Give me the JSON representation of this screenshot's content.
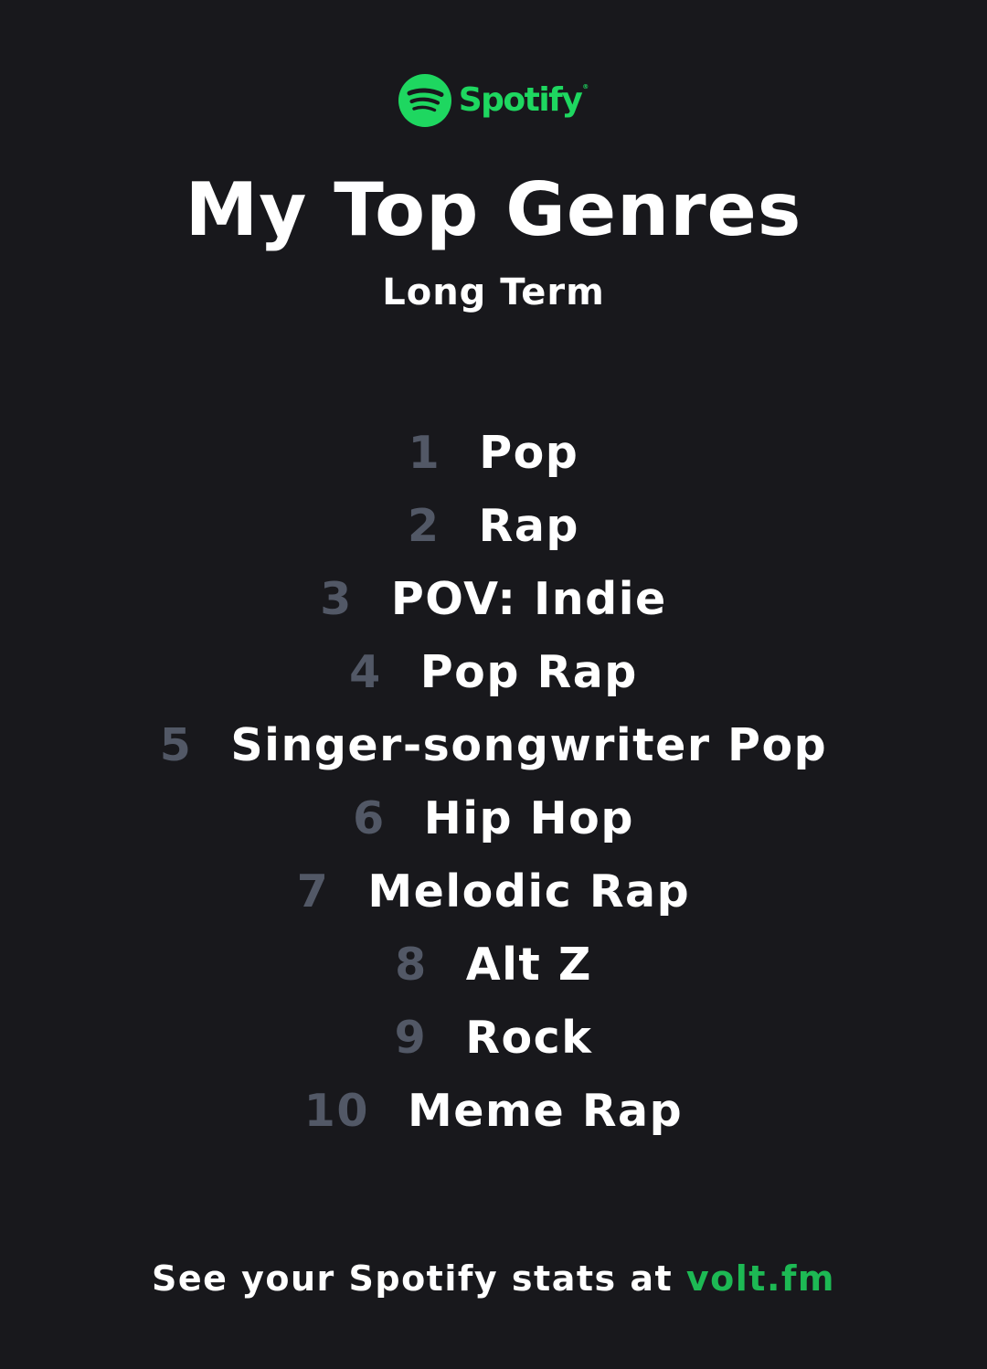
{
  "brand": {
    "name": "Spotify",
    "registered_mark": "®",
    "accent_color": "#1ed760",
    "icon": "spotify-logo-icon"
  },
  "header": {
    "title": "My Top Genres",
    "subtitle": "Long Term"
  },
  "genres": [
    {
      "rank": "1",
      "name": "Pop"
    },
    {
      "rank": "2",
      "name": "Rap"
    },
    {
      "rank": "3",
      "name": "POV: Indie"
    },
    {
      "rank": "4",
      "name": "Pop Rap"
    },
    {
      "rank": "5",
      "name": "Singer-songwriter Pop"
    },
    {
      "rank": "6",
      "name": "Hip Hop"
    },
    {
      "rank": "7",
      "name": "Melodic Rap"
    },
    {
      "rank": "8",
      "name": "Alt Z"
    },
    {
      "rank": "9",
      "name": "Rock"
    },
    {
      "rank": "10",
      "name": "Meme Rap"
    }
  ],
  "footer": {
    "text": "See your Spotify stats at ",
    "link": "volt.fm",
    "link_color": "#1db954"
  },
  "colors": {
    "background": "#18181c",
    "rank": "#525866",
    "text": "#ffffff"
  }
}
